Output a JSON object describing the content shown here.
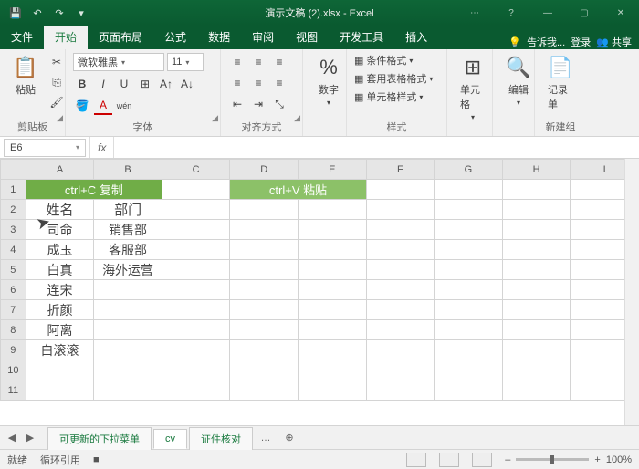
{
  "title": "演示文稿 (2).xlsx - Excel",
  "qat": {
    "save": "💾",
    "undo": "↶",
    "redo": "↷"
  },
  "win": {
    "help": "?",
    "min": "—",
    "max": "▢",
    "close": "✕",
    "opts": "⋯"
  },
  "tabs": {
    "file": "文件",
    "home": "开始",
    "layout": "页面布局",
    "formulas": "公式",
    "data": "数据",
    "review": "审阅",
    "view": "视图",
    "dev": "开发工具",
    "insert": "插入",
    "tell": "告诉我...",
    "login": "登录",
    "share": "共享"
  },
  "ribbon": {
    "clipboard": {
      "paste": "粘贴",
      "label": "剪贴板",
      "cut": "✂",
      "copy": "⎘",
      "painter": "🖌"
    },
    "font": {
      "name": "微软雅黑",
      "size": "11",
      "label": "字体",
      "bold": "B",
      "italic": "I",
      "underline": "U",
      "border": "⊞",
      "fill": "🪣",
      "color": "A",
      "grow": "A↑",
      "shrink": "A↓",
      "phonetic": "wén"
    },
    "align": {
      "label": "对齐方式",
      "tl": "≡",
      "tc": "≡",
      "tr": "≡",
      "ml": "≡",
      "mc": "≡",
      "mr": "≡",
      "indent_dec": "⇤",
      "indent_inc": "⇥",
      "wrap": "↩",
      "merge": "⊟"
    },
    "number": {
      "btn": "%",
      "label": "数字"
    },
    "styles": {
      "cond": "条件格式",
      "table": "套用表格格式",
      "cell": "单元格样式",
      "label": "样式"
    },
    "cells": {
      "btn": "单元格"
    },
    "editing": {
      "btn": "编辑"
    },
    "record": {
      "btn": "记录单",
      "label": "新建组"
    }
  },
  "namebox": "E6",
  "fx": "fx",
  "cols": [
    "A",
    "B",
    "C",
    "D",
    "E",
    "F",
    "G",
    "H",
    "I"
  ],
  "rows": [
    "1",
    "2",
    "3",
    "4",
    "5",
    "6",
    "7",
    "8",
    "9",
    "10",
    "11"
  ],
  "banners": {
    "copy": "ctrl+C 复制",
    "paste": "ctrl+V 粘贴"
  },
  "grid": {
    "headers": {
      "name": "姓名",
      "dept": "部门"
    },
    "data": [
      {
        "name": "司命",
        "dept": "销售部"
      },
      {
        "name": "成玉",
        "dept": "客服部"
      },
      {
        "name": "白真",
        "dept": "海外运营"
      },
      {
        "name": "连宋",
        "dept": ""
      },
      {
        "name": "折颜",
        "dept": ""
      },
      {
        "name": "阿离",
        "dept": ""
      },
      {
        "name": "白滚滚",
        "dept": ""
      }
    ]
  },
  "sheets": {
    "nav_l": "◀",
    "nav_r": "▶",
    "s1": "可更新的下拉菜单",
    "s2": "cv",
    "s3": "证件核对",
    "more": "…",
    "add": "⊕"
  },
  "status": {
    "ready": "就绪",
    "circ": "循环引用",
    "rec": "■",
    "zoom": "100%",
    "plus": "+",
    "minus": "–"
  }
}
